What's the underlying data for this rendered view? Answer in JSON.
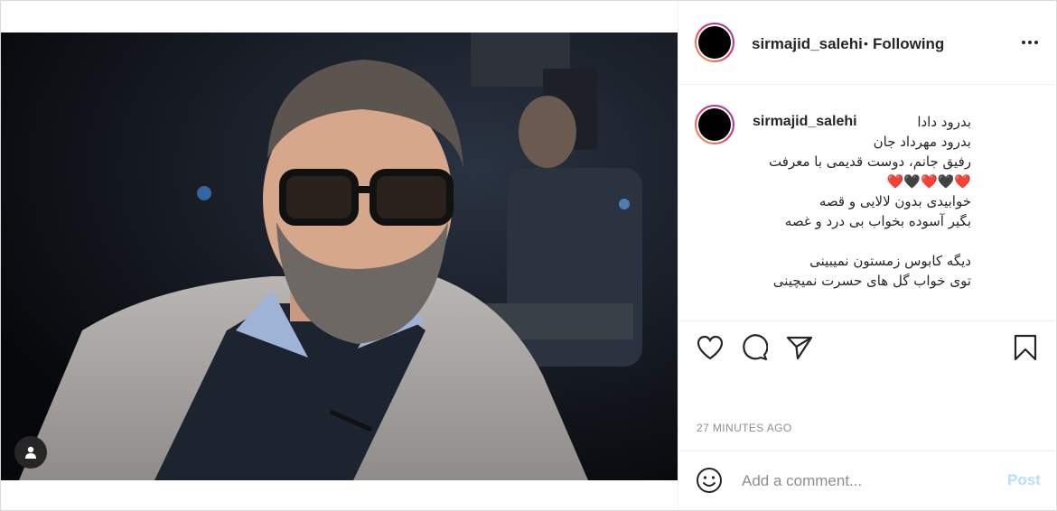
{
  "header": {
    "username": "sirmajid_salehi",
    "separator": "•",
    "follow_status": "Following"
  },
  "caption": {
    "username": "sirmajid_salehi",
    "lines": [
      "بدرود دادا",
      "بدرود مهرداد جان",
      "رفیق جانم، دوست قدیمی با معرفت",
      "❤️🖤❤️🖤❤️",
      "خوابیدی بدون لالایی و قصه",
      "بگیر آسوده بخواب بی درد و غصه",
      "",
      "دیگه کابوس زمستون نمیبینی",
      "توی خواب گل های حسرت نمیچینی"
    ]
  },
  "hearts": [
    "red",
    "black",
    "red",
    "black",
    "red"
  ],
  "timestamp": "27 MINUTES AGO",
  "comment": {
    "placeholder": "Add a comment...",
    "post_label": "Post"
  },
  "colors": {
    "red_heart": "#d81f34",
    "black_heart": "#333333",
    "post_disabled": "#b2dffc",
    "meta_gray": "#8e8e8e"
  },
  "icons": [
    "user-tag-icon",
    "more-options-icon",
    "heart-icon",
    "comment-icon",
    "share-icon",
    "bookmark-icon",
    "emoji-icon"
  ]
}
